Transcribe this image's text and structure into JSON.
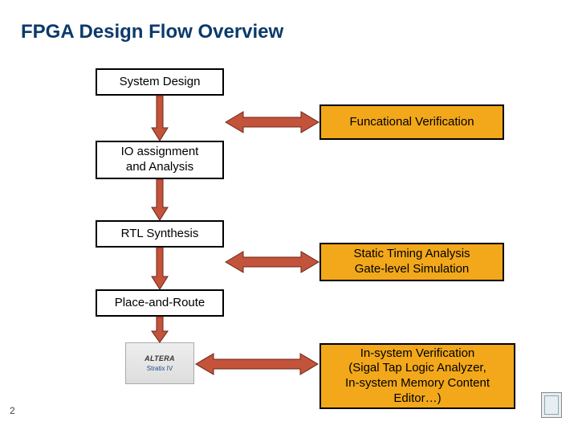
{
  "title": "FPGA Design Flow Overview",
  "page_number": "2",
  "left_boxes": {
    "system_design": "System Design",
    "io_assign": "IO assignment\nand Analysis",
    "rtl": "RTL Synthesis",
    "par": "Place-and-Route"
  },
  "right_boxes": {
    "func_verif": "Funcational Verification",
    "sta_gls": "Static Timing Analysis\nGate-level Simulation",
    "insystem": "In-system Verification\n(Sigal Tap Logic Analyzer,\nIn-system Memory Content\nEditor…)"
  },
  "chip": {
    "brand": "ALTERA",
    "family": "Stratix IV"
  },
  "colors": {
    "title": "#0b3a6b",
    "highlight_bg": "#f2a81a",
    "arrow_fill": "#c3533a"
  }
}
